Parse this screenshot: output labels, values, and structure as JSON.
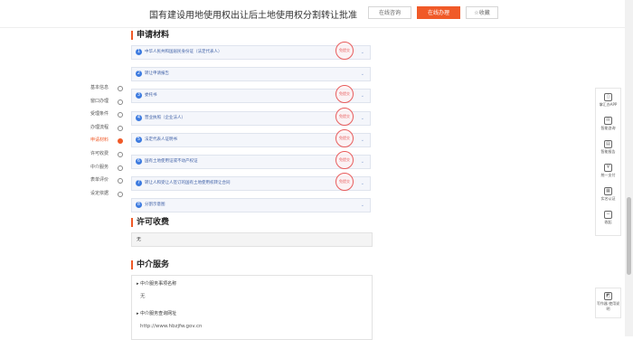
{
  "header": {
    "title": "国有建设用地使用权出让后土地使用权分割转让批准",
    "consult_label": "在线咨询",
    "apply_label": "在线办理",
    "fav_label": "收藏"
  },
  "left_nav": {
    "items": [
      "基本信息",
      "窗口办理",
      "受理条件",
      "办理流程",
      "申请材料",
      "许可收费",
      "中介服务",
      "表单评价",
      "设定依据"
    ],
    "active_index": 4
  },
  "materials": {
    "title": "申请材料",
    "stamp_label": "免提交",
    "items": [
      {
        "num": "1",
        "label": "中华人民共和国居民身份证（法定代表人）",
        "stamp": true
      },
      {
        "num": "2",
        "label": "转让申请报告",
        "stamp": false
      },
      {
        "num": "3",
        "label": "委托书",
        "stamp": true
      },
      {
        "num": "4",
        "label": "营业执照（企业法人）",
        "stamp": true
      },
      {
        "num": "5",
        "label": "法定代表人证明书",
        "stamp": true
      },
      {
        "num": "6",
        "label": "国有土地使用证或不动产权证",
        "stamp": true
      },
      {
        "num": "7",
        "label": "转让人和受让人签订的国有土地使用权转让合同",
        "stamp": true
      },
      {
        "num": "8",
        "label": "分割示意图",
        "stamp": false
      }
    ]
  },
  "fees": {
    "title": "许可收费",
    "value": "无"
  },
  "intermediary": {
    "title": "中介服务",
    "name_label": "中介服务事项名称",
    "name_value": "无",
    "url_label": "中介服务查询网址",
    "url_value": "http://www.hbzjfw.gov.cn"
  },
  "right_bar": {
    "items": [
      {
        "icon": "phone-icon",
        "glyph": "▯",
        "label": "掌汇办APP"
      },
      {
        "icon": "consult-icon",
        "glyph": "✉",
        "label": "智能咨询"
      },
      {
        "icon": "report-icon",
        "glyph": "▤",
        "label": "智能报告"
      },
      {
        "icon": "pay-icon",
        "glyph": "¥",
        "label": "统一支付"
      },
      {
        "icon": "qr-icon",
        "glyph": "▦",
        "label": "实名认证"
      },
      {
        "icon": "collapse-icon",
        "glyph": "−",
        "label": "收起"
      }
    ],
    "guide": {
      "icon": "guide-icon",
      "glyph": "◩",
      "label": "写作器 使用说明"
    }
  },
  "colors": {
    "accent": "#f05a28",
    "link_blue": "#3d5fa6",
    "stamp_red": "#e85d5d"
  }
}
